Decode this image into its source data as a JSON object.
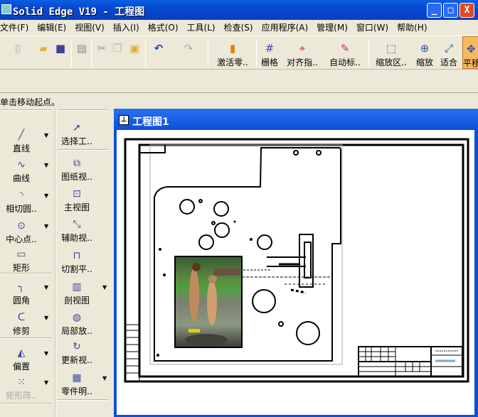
{
  "window": {
    "title": "Solid Edge V19 - 工程图",
    "minimize": "_",
    "maximize": "□",
    "close": "X"
  },
  "menu": [
    "文件(F)",
    "编辑(E)",
    "视图(V)",
    "插入(I)",
    "格式(O)",
    "工具(L)",
    "检查(S)",
    "应用程序(A)",
    "管理(M)",
    "窗口(W)",
    "帮助(H)"
  ],
  "toolbar": {
    "activate": "激活零..",
    "grid": "栅格",
    "align": "对齐指..",
    "autodim": "自动标..",
    "zoom_area": "缩放区..",
    "zoom": "缩放",
    "fit": "适合",
    "pan": "平移"
  },
  "status": "单击移动起点。",
  "left_col1": [
    {
      "label": "直线",
      "icon": "line-icon"
    },
    {
      "label": "曲线",
      "icon": "curve-icon"
    },
    {
      "label": "相切圆..",
      "icon": "tangent-arc-icon"
    },
    {
      "label": "中心点..",
      "icon": "circle-center-icon"
    },
    {
      "label": "矩形",
      "icon": "rectangle-icon"
    },
    {
      "label": "圆角",
      "icon": "fillet-icon"
    },
    {
      "label": "修剪",
      "icon": "trim-icon"
    },
    {
      "label": "偏置",
      "icon": "offset-icon"
    },
    {
      "label": "矩形阵..",
      "icon": "pattern-icon"
    }
  ],
  "left_col2": [
    {
      "label": "选择工..",
      "icon": "select-arrow-icon"
    },
    {
      "label": "图纸视..",
      "icon": "drawing-view-icon"
    },
    {
      "label": "主视图",
      "icon": "principal-view-icon"
    },
    {
      "label": "辅助视..",
      "icon": "auxiliary-view-icon"
    },
    {
      "label": "切割平..",
      "icon": "cutting-plane-icon"
    },
    {
      "label": "剖视图",
      "icon": "section-view-icon"
    },
    {
      "label": "局部放..",
      "icon": "detail-view-icon"
    },
    {
      "label": "更新视..",
      "icon": "update-view-icon"
    },
    {
      "label": "零件明..",
      "icon": "parts-list-icon"
    }
  ],
  "document": {
    "title": "工程图1"
  }
}
